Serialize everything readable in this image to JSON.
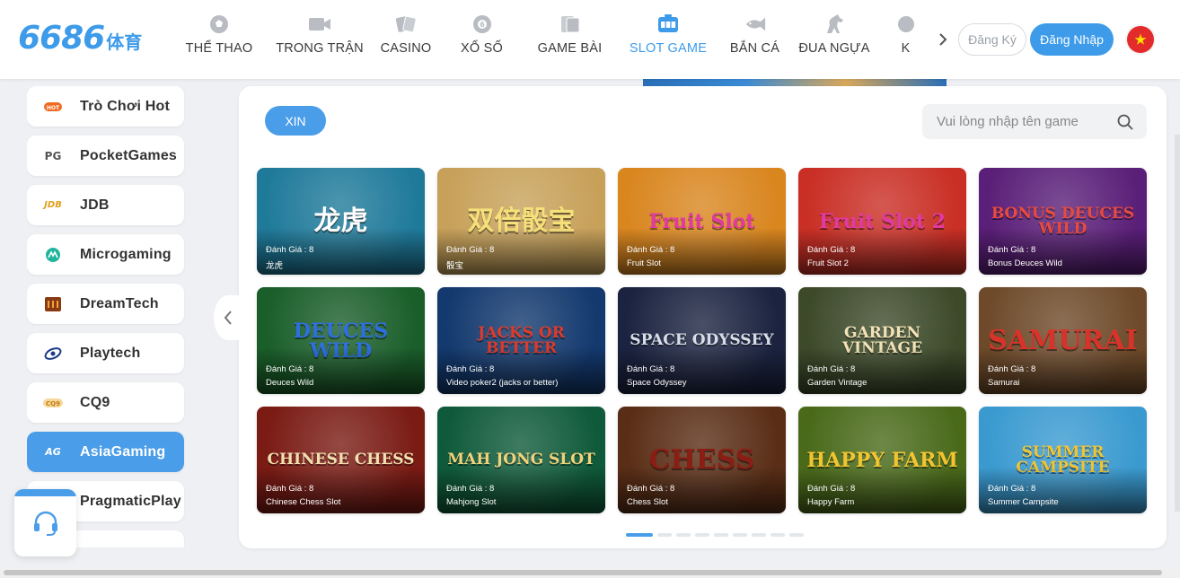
{
  "header": {
    "logo_number": "6686",
    "logo_suffix": "体育",
    "nav": [
      {
        "label": "THỂ THAO",
        "icon": "soccer-ball-icon",
        "active": false
      },
      {
        "label": "TRONG TRẬN",
        "icon": "video-camera-icon",
        "active": false
      },
      {
        "label": "CASINO",
        "icon": "playing-cards-icon",
        "active": false
      },
      {
        "label": "XỔ SỐ",
        "icon": "lottery-ball-icon",
        "active": false
      },
      {
        "label": "GAME BÀI",
        "icon": "card-game-icon",
        "active": false
      },
      {
        "label": "SLOT GAME",
        "icon": "slot-machine-icon",
        "active": true
      },
      {
        "label": "BẮN CÁ",
        "icon": "fish-icon",
        "active": false
      },
      {
        "label": "ĐUA NGỰA",
        "icon": "horse-icon",
        "active": false
      },
      {
        "label": "K",
        "icon": "more-icon",
        "active": false
      }
    ],
    "register_label": "Đăng Ký",
    "login_label": "Đăng Nhập",
    "accent": "#3d9be9"
  },
  "sidebar": {
    "items": [
      {
        "label": "Trò Chơi Hot",
        "icon": "hot-flame-icon",
        "icon_text": "HOT",
        "active": false
      },
      {
        "label": "PocketGames",
        "icon": "pg-logo-icon",
        "icon_text": "PG",
        "active": false
      },
      {
        "label": "JDB",
        "icon": "jdb-logo-icon",
        "icon_text": "JDB",
        "active": false
      },
      {
        "label": "Microgaming",
        "icon": "microgaming-logo-icon",
        "icon_text": "M",
        "active": false
      },
      {
        "label": "DreamTech",
        "icon": "dreamtech-logo-icon",
        "icon_text": "",
        "active": false
      },
      {
        "label": "Playtech",
        "icon": "playtech-logo-icon",
        "icon_text": "",
        "active": false
      },
      {
        "label": "CQ9",
        "icon": "cq9-logo-icon",
        "icon_text": "CQ9",
        "active": false
      },
      {
        "label": "AsiaGaming",
        "icon": "ag-logo-icon",
        "icon_text": "AG",
        "active": true
      },
      {
        "label": "PragmaticPlay",
        "icon": "pragmatic-logo-icon",
        "icon_text": "",
        "active": false
      },
      {
        "label": "",
        "icon": "provider-logo-icon",
        "icon_text": "",
        "active": false
      }
    ]
  },
  "main": {
    "filter_label": "XIN",
    "search_placeholder": "Vui lòng nhập tên game",
    "games": [
      {
        "rating": "Đánh Giá : 8",
        "name": "龙虎",
        "art_title": "龙虎",
        "bg": "#1f7a9a",
        "fg": "#ffffff"
      },
      {
        "rating": "Đánh Giá : 8",
        "name": "骰宝",
        "art_title": "双倍骰宝",
        "bg": "#c7a15a",
        "fg": "#f6e07a"
      },
      {
        "rating": "Đánh Giá : 8",
        "name": "Fruit Slot",
        "art_title": "Fruit Slot",
        "bg": "#d9861f",
        "fg": "#e23aa3"
      },
      {
        "rating": "Đánh Giá : 8",
        "name": "Fruit Slot 2",
        "art_title": "Fruit Slot 2",
        "bg": "#c92f25",
        "fg": "#e23aa3"
      },
      {
        "rating": "Đánh Giá : 8",
        "name": "Bonus Deuces Wild",
        "art_title": "BONUS DEUCES WILD",
        "bg": "#5a1f78",
        "fg": "#e94b3c"
      },
      {
        "rating": "Đánh Giá : 8",
        "name": "Deuces Wild",
        "art_title": "DEUCES WILD",
        "bg": "#1a5e2a",
        "fg": "#2e6fe0"
      },
      {
        "rating": "Đánh Giá : 8",
        "name": "Video poker2 (jacks or better)",
        "art_title": "JACKS OR BETTER",
        "bg": "#13396e",
        "fg": "#e03a2a"
      },
      {
        "rating": "Đánh Giá : 8",
        "name": "Space Odyssey",
        "art_title": "SPACE ODYSSEY",
        "bg": "#1b2340",
        "fg": "#d8dee8"
      },
      {
        "rating": "Đánh Giá : 8",
        "name": "Garden Vintage",
        "art_title": "GARDEN VINTAGE",
        "bg": "#3d4a2a",
        "fg": "#f2e3b8"
      },
      {
        "rating": "Đánh Giá : 8",
        "name": "Samurai",
        "art_title": "SAMURAI",
        "bg": "#6e4a2a",
        "fg": "#d8332a"
      },
      {
        "rating": "Đánh Giá : 8",
        "name": "Chinese Chess Slot",
        "art_title": "CHINESE CHESS",
        "bg": "#7a1b14",
        "fg": "#f2e0b0"
      },
      {
        "rating": "Đánh Giá : 8",
        "name": "Mahjong Slot",
        "art_title": "MAH JONG SLOT",
        "bg": "#0f5a3a",
        "fg": "#f2d27a"
      },
      {
        "rating": "Đánh Giá : 8",
        "name": "Chess Slot",
        "art_title": "CHESS",
        "bg": "#5a2e16",
        "fg": "#8a1e14"
      },
      {
        "rating": "Đánh Giá : 8",
        "name": "Happy Farm",
        "art_title": "HAPPY FARM",
        "bg": "#4a6a1a",
        "fg": "#f2c430"
      },
      {
        "rating": "Đánh Giá : 8",
        "name": "Summer Campsite",
        "art_title": "SUMMER CAMPSITE",
        "bg": "#3a9ad0",
        "fg": "#f2c430"
      }
    ],
    "pagination_total": 9,
    "pagination_active": 1
  }
}
